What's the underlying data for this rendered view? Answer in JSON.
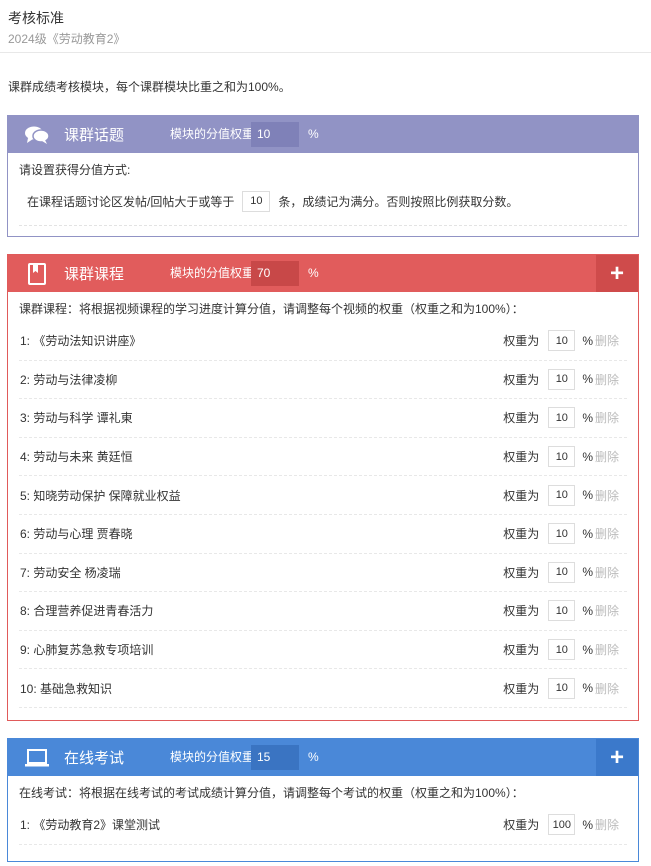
{
  "header": {
    "title": "考核标准",
    "subtitle": "2024级《劳动教育2》"
  },
  "intro": "课群成绩考核模块，每个课群模块比重之和为100%。",
  "common": {
    "weight_label": "模块的分值权重",
    "percent": "%",
    "item_weight_label": "权重为",
    "delete_label": "删除",
    "add_symbol": "+"
  },
  "modules": [
    {
      "name": "课群话题",
      "weight": "10",
      "desc": "请设置获得分值方式:",
      "rule": {
        "prefix": "在课程话题讨论区发帖/回帖大于或等于",
        "value": "10",
        "suffix": "条，成绩记为满分。否则按照比例获取分数。"
      }
    },
    {
      "name": "课群课程",
      "weight": "70",
      "desc": "课群课程：将根据视频课程的学习进度计算分值，请调整每个视频的权重（权重之和为100%）：",
      "items": [
        {
          "label": "1: 《劳动法知识讲座》",
          "weight": "10"
        },
        {
          "label": "2:   劳动与法律凌柳",
          "weight": "10"
        },
        {
          "label": "3: 劳动与科学 谭礼東",
          "weight": "10"
        },
        {
          "label": "4: 劳动与未来 黄廷恒",
          "weight": "10"
        },
        {
          "label": "5: 知晓劳动保护 保障就业权益",
          "weight": "10"
        },
        {
          "label": "6:   劳动与心理 贾春晓",
          "weight": "10"
        },
        {
          "label": "7:   劳动安全 杨凌瑞",
          "weight": "10"
        },
        {
          "label": "8: 合理营养促进青春活力",
          "weight": "10"
        },
        {
          "label": "9: 心肺复苏急救专项培训",
          "weight": "10"
        },
        {
          "label": "10: 基础急救知识",
          "weight": "10"
        }
      ]
    },
    {
      "name": "在线考试",
      "weight": "15",
      "desc": "在线考试：将根据在线考试的考试成绩计算分值，请调整每个考试的权重（权重之和为100%）：",
      "items": [
        {
          "label": "1: 《劳动教育2》课堂测试",
          "weight": "100"
        }
      ]
    }
  ],
  "colors": {
    "topic": "#9193c5",
    "course": "#e15c5c",
    "exam": "#4a88d8"
  },
  "icons": [
    "chat-bubbles-icon",
    "book-icon",
    "laptop-icon",
    "plus-icon"
  ]
}
